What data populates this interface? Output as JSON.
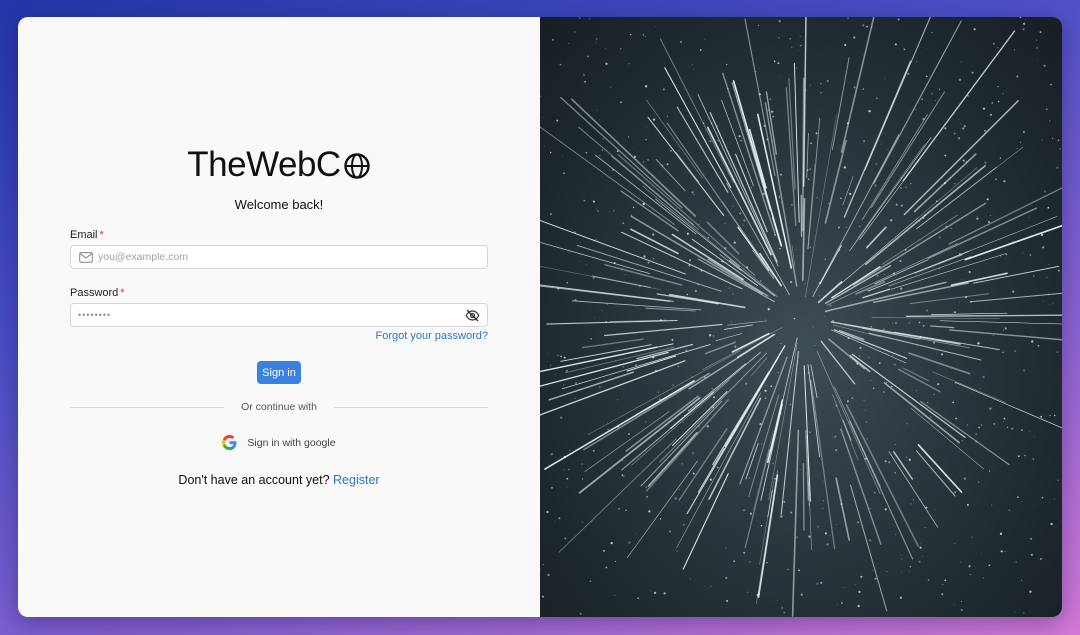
{
  "brand": {
    "name": "TheWebC",
    "logo_icon": "globe-icon"
  },
  "form": {
    "welcome": "Welcome back!",
    "email_label": "Email",
    "email_placeholder": "you@example.com",
    "email_icon": "mail-icon",
    "password_label": "Password",
    "password_value": "••••••••",
    "password_toggle_icon": "eye-off-icon",
    "required_marker": "*",
    "forgot_link": "Forgot your password?",
    "submit_label": "Sign in"
  },
  "alt_login": {
    "divider_text": "Or continue with",
    "google_label": "Sign in with google",
    "google_icon": "google-icon"
  },
  "footer": {
    "prompt": "Don't have an account yet?",
    "register_link": "Register"
  },
  "colors": {
    "primary": "#3b82e0",
    "link": "#2e76c7",
    "required": "#e03131",
    "left_panel_bg": "#f9f9fa"
  },
  "hero": {
    "image": "starfield-hyperspace"
  }
}
